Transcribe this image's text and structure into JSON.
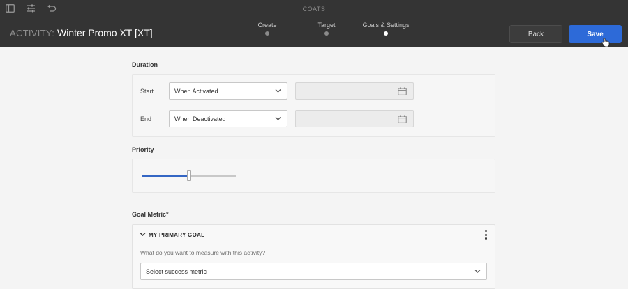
{
  "header": {
    "app_name": "COATS",
    "activity_prefix": "ACTIVITY:",
    "activity_name": "Winter Promo XT [XT]",
    "icons": [
      "panel-icon",
      "sliders-icon",
      "undo-icon"
    ],
    "steps": [
      {
        "label": "Create",
        "active": false
      },
      {
        "label": "Target",
        "active": false
      },
      {
        "label": "Goals & Settings",
        "active": true
      }
    ],
    "back_label": "Back",
    "save_label": "Save"
  },
  "duration": {
    "title": "Duration",
    "start": {
      "label": "Start",
      "value": "When Activated",
      "date_value": ""
    },
    "end": {
      "label": "End",
      "value": "When Deactivated",
      "date_value": ""
    }
  },
  "priority": {
    "title": "Priority",
    "level": 0.5
  },
  "goal": {
    "title": "Goal Metric*",
    "card_title": "MY PRIMARY GOAL",
    "question": "What do you want to measure with this activity?",
    "metric_value": "Select success metric"
  },
  "colors": {
    "header_bg": "#343434",
    "save_button": "#2d6ad8",
    "slider_fill": "#3466c4",
    "page_bg": "#f4f4f4"
  }
}
